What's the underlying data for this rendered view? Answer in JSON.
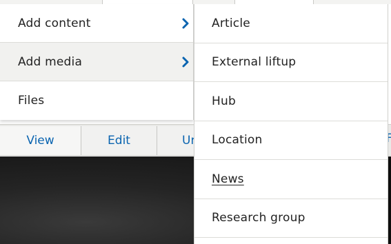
{
  "menu": {
    "items": [
      {
        "label": "Add content",
        "has_submenu": true,
        "highlighted": false
      },
      {
        "label": "Add media",
        "has_submenu": true,
        "highlighted": true
      },
      {
        "label": "Files",
        "has_submenu": false,
        "highlighted": false
      }
    ]
  },
  "submenu": {
    "items": [
      {
        "label": "Article"
      },
      {
        "label": "External liftup"
      },
      {
        "label": "Hub"
      },
      {
        "label": "Location"
      },
      {
        "label": "News"
      },
      {
        "label": "Research group"
      }
    ]
  },
  "tabs": {
    "items": [
      {
        "label": "View"
      },
      {
        "label": "Edit"
      },
      {
        "label": "Ur"
      }
    ],
    "edge_label": "F"
  },
  "colors": {
    "link": "#0a64b0",
    "chevron": "#0a64b0",
    "menu_text": "#222222",
    "highlight": "#f1f1ef"
  }
}
